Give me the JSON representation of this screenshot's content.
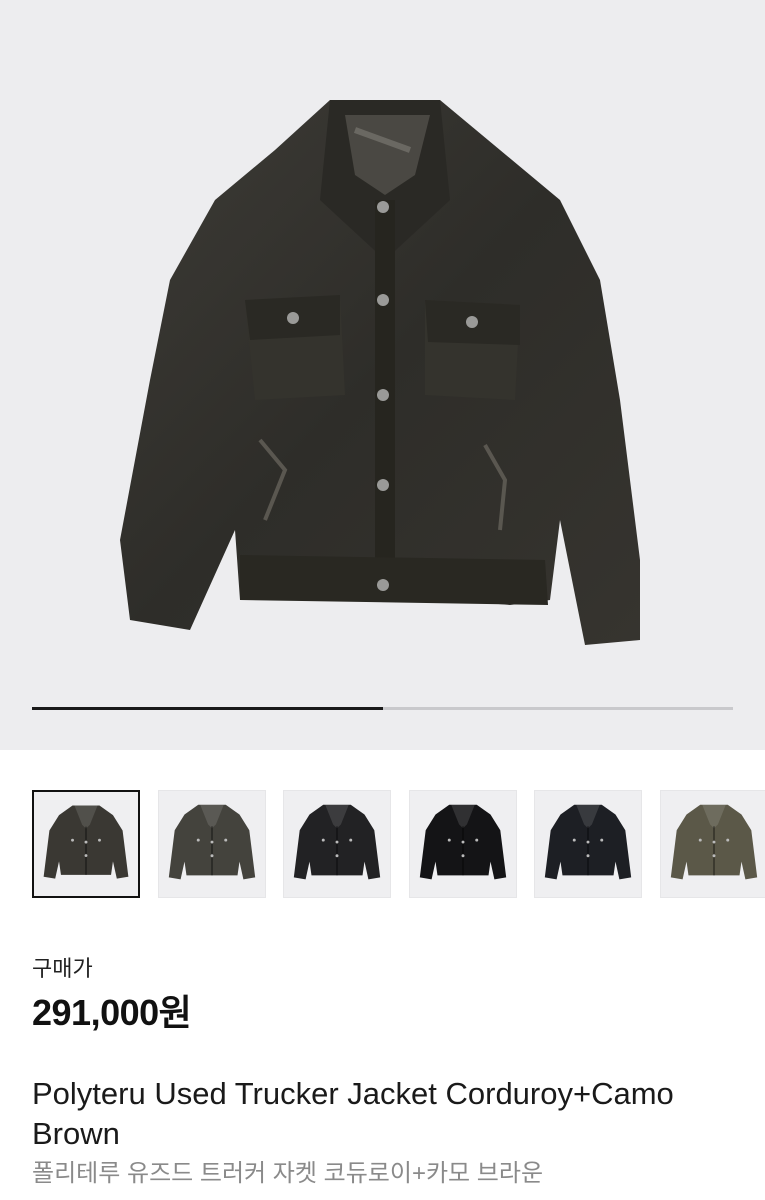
{
  "gallery": {
    "main_image": "corduroy trucker jacket, dark brown",
    "progress": 0.5
  },
  "thumbnails": [
    {
      "name": "thumb-1",
      "color": "#3a3833",
      "selected": true
    },
    {
      "name": "thumb-2",
      "color": "#44433d",
      "selected": false
    },
    {
      "name": "thumb-3",
      "color": "#222224",
      "selected": false
    },
    {
      "name": "thumb-4",
      "color": "#141416",
      "selected": false
    },
    {
      "name": "thumb-5",
      "color": "#1d1f24",
      "selected": false
    },
    {
      "name": "thumb-6",
      "color": "#5b5848",
      "selected": false
    }
  ],
  "product": {
    "price_label": "구매가",
    "price": "291,000원",
    "title": "Polyteru Used Trucker Jacket Corduroy+Camo Brown",
    "subtitle": "폴리테루 유즈드 트러커 자켓 코듀로이+카모 브라운"
  }
}
